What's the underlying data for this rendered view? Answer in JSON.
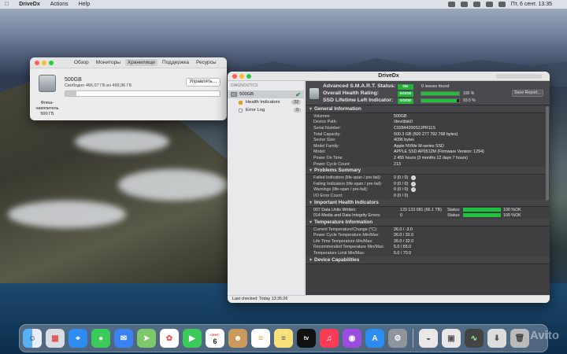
{
  "menubar": {
    "app": "DriveDx",
    "items": [
      "Actions",
      "Help"
    ],
    "clock": "Пт, 6 сент. 13:35"
  },
  "disk_utility": {
    "tabs": [
      "Обзор",
      "Мониторы",
      "Хранилище",
      "Поддержка",
      "Ресурсы"
    ],
    "selected_tab": "Хранилище",
    "disk_name": "500GB",
    "free_text": "Свободно 466,07 ГБ из 499,96 ГБ",
    "manage_label": "Управлять…",
    "disk_label": "Флеш-накопитель 500 ГБ",
    "used_fraction": 0.07
  },
  "drivedx": {
    "title": "DriveDx",
    "sidebar": {
      "header": "DIAGNOSTICS",
      "drive": "500GB",
      "items": [
        {
          "label": "Health Indicators",
          "count": "22",
          "color": "#e0a020"
        },
        {
          "label": "Error Log",
          "count": "0",
          "color": "#eeeeee"
        }
      ]
    },
    "summary": {
      "rows": [
        {
          "label": "Advanced S.M.A.R.T. Status:",
          "badge": "OK",
          "extra": "0 issues found"
        },
        {
          "label": "Overall Health Rating:",
          "badge": "GOOD",
          "pct": "100 %",
          "fill": 1.0
        },
        {
          "label": "SSD Lifetime Left Indicator:",
          "badge": "GOOD",
          "pct": "93.0 %",
          "fill": 0.93
        }
      ],
      "save_report": "Save Report..."
    },
    "general": {
      "title": "General Information",
      "rows": [
        {
          "k": "Volumes:",
          "v": "500GB"
        },
        {
          "k": "Device Path:",
          "v": "/dev/disk0"
        },
        {
          "k": "Serial Number:",
          "v": "C02844200S2JPR11S"
        },
        {
          "k": "Total Capacity:",
          "v": "500.3 GB (500 277 792 768 bytes)"
        },
        {
          "k": "Sector Size:",
          "v": "4096 bytes"
        },
        {
          "k": "Model Family:",
          "v": "Apple NVMe M-series SSD"
        },
        {
          "k": "Model:",
          "v": "APPLE SSD AP0512M  (Firmware Version: 1294)"
        },
        {
          "k": "Power On Time:",
          "v": "2 455 hours (3 months 12 days 7 hours)"
        },
        {
          "k": "Power Cycle Count:",
          "v": "213"
        }
      ]
    },
    "problems": {
      "title": "Problems Summary",
      "rows": [
        {
          "k": "Failed Indicators (life-span / pre-fail):",
          "v": "0 (0 / 0)"
        },
        {
          "k": "Failing Indicators (life-span / pre-fail):",
          "v": "0 (0 / 0)"
        },
        {
          "k": "Warnings (life-span / pre-fail):",
          "v": "0 (0 / 0)"
        },
        {
          "k": "I/O Error Count:",
          "v": "0 (0 / 0)"
        }
      ]
    },
    "health": {
      "title": "Important Health Indicators",
      "rows": [
        {
          "k": "007  Data Units Written:",
          "v": "129 133 081 (66.1 TB)",
          "st": "Status:",
          "pc": "100 %",
          "ok": "OK"
        },
        {
          "k": "014  Media and Data Integrity Errors:",
          "v": "0",
          "st": "Status:",
          "pc": "100 %",
          "ok": "OK"
        }
      ]
    },
    "temperature": {
      "title": "Temperature Information",
      "rows": [
        {
          "k": "Current Temperature/Change (°C):",
          "v": "26.0 / -3.0"
        },
        {
          "k": "Power Cycle Temperature Min/Max:",
          "v": "26.0 / 32.0"
        },
        {
          "k": "Life Time Temperature Min/Max:",
          "v": "26.0 / 32.0"
        },
        {
          "k": "Recommended Temperature Min/Max:",
          "v": "5.0   / 65.0"
        },
        {
          "k": "Temperature Limit Min/Max:",
          "v": "5.0   / 70.0"
        }
      ]
    },
    "capabilities": {
      "title": "Device Capabilities"
    },
    "status_bar": "Last checked: Today 13:35:26"
  },
  "dock": {
    "calendar_month": "СЕНТ.",
    "calendar_day": "6",
    "tv_label": "tv",
    "apps": [
      "finder-icon",
      "launchpad-icon",
      "safari-icon",
      "messages-icon",
      "mail-icon",
      "maps-icon",
      "photos-icon",
      "facetime-icon",
      "calendar-icon",
      "contacts-icon",
      "reminders-icon",
      "notes-icon",
      "tv-icon",
      "music-icon",
      "podcasts-icon",
      "appstore-icon",
      "settings-icon"
    ]
  },
  "watermark": "Avito"
}
